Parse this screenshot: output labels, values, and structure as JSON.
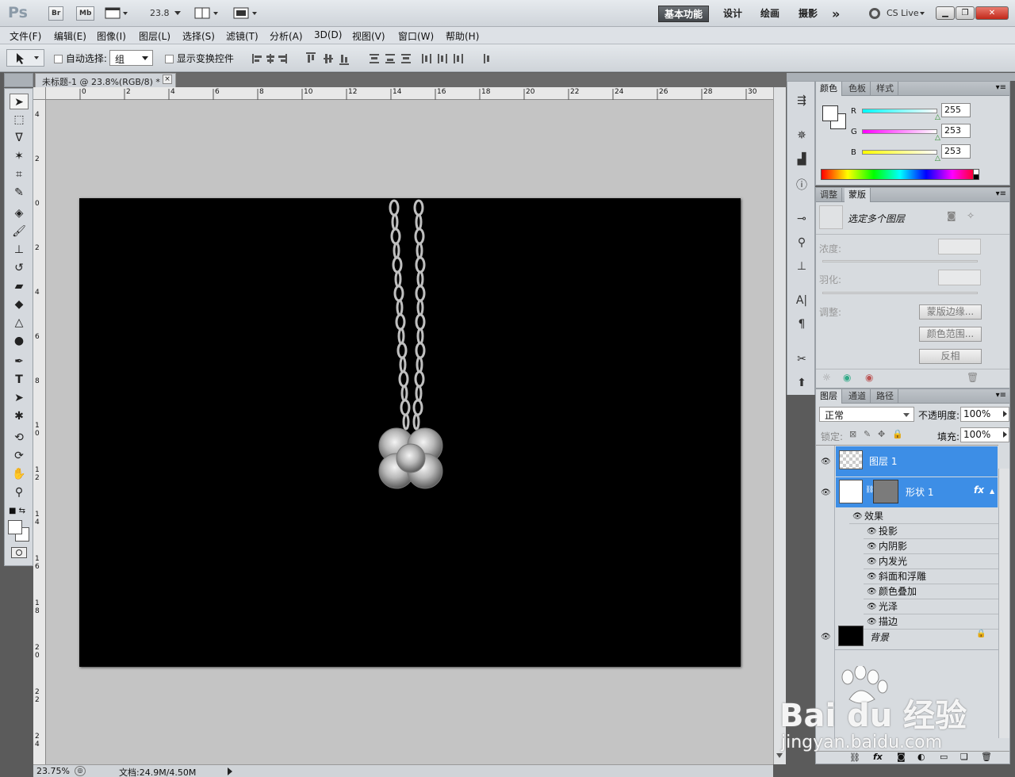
{
  "titlebar": {
    "logo": "Ps",
    "bridge": "Br",
    "minibridge": "Mb",
    "zoom": "23.8",
    "workspaces": [
      "基本功能",
      "设计",
      "绘画",
      "摄影"
    ],
    "more": "»",
    "cslive": "CS Live"
  },
  "menu": [
    "文件(F)",
    "编辑(E)",
    "图像(I)",
    "图层(L)",
    "选择(S)",
    "滤镜(T)",
    "分析(A)",
    "3D(D)",
    "视图(V)",
    "窗口(W)",
    "帮助(H)"
  ],
  "options": {
    "auto_select_label": "自动选择:",
    "auto_select_value": "组",
    "show_transform_label": "显示变换控件"
  },
  "document": {
    "tab_title": "未标题-1 @ 23.8%(RGB/8) *",
    "close": "×",
    "ruler_h": [
      "0",
      "2",
      "4",
      "6",
      "8",
      "10",
      "12",
      "14",
      "16",
      "18",
      "20",
      "22",
      "24",
      "26",
      "28",
      "30"
    ],
    "ruler_v": [
      "4",
      "2",
      "0",
      "2",
      "4",
      "6",
      "8",
      "1 0",
      "1 2",
      "1 4",
      "1 6",
      "1 8",
      "2 0",
      "2 2",
      "2 4"
    ]
  },
  "status": {
    "zoom": "23.75%",
    "doc": "文档:24.9M/4.50M"
  },
  "color_panel": {
    "tabs": [
      "颜色",
      "色板",
      "样式"
    ],
    "r_label": "R",
    "r": "255",
    "g_label": "G",
    "g": "253",
    "b_label": "B",
    "b": "253",
    "colors": {
      "r_slider": "#00ffff",
      "g_slider": "#ff00ff",
      "b_slider": "#ffff00"
    }
  },
  "mask_panel": {
    "tabs": [
      "调整",
      "蒙版"
    ],
    "title": "选定多个图层",
    "density": "浓度:",
    "feather": "羽化:",
    "refine": "调整:",
    "mask_edge": "蒙版边缘...",
    "color_range": "颜色范围...",
    "invert": "反相"
  },
  "layers_panel": {
    "tabs": [
      "图层",
      "通道",
      "路径"
    ],
    "blend": "正常",
    "opacity_label": "不透明度:",
    "opacity": "100%",
    "lock_label": "锁定:",
    "fill_label": "填充:",
    "fill": "100%",
    "layers": [
      "图层 1",
      "形状 1",
      "背景"
    ],
    "fx": "fx",
    "effects_label": "效果",
    "effects": [
      "投影",
      "内阴影",
      "内发光",
      "斜面和浮雕",
      "颜色叠加",
      "光泽",
      "描边"
    ],
    "colors": {
      "selected": "#3d8ee6"
    }
  },
  "watermark": {
    "logo": "Bai du 经验",
    "url": "jingyan.baidu.com"
  }
}
